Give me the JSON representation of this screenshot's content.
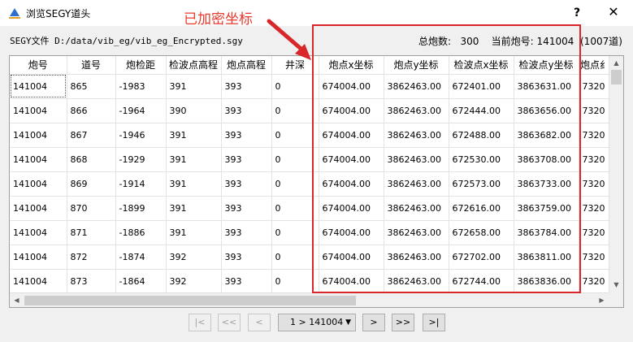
{
  "window": {
    "title": "浏览SEGY道头",
    "help_label": "?",
    "close_label": "✕"
  },
  "annotation": {
    "text": "已加密坐标",
    "color": "#e8392c"
  },
  "info": {
    "file_label": "SEGY文件",
    "file_path": "D:/data/vib_eg/vib_eg_Encrypted.sgy",
    "total_shots_label": "总炮数:",
    "total_shots_value": "300",
    "current_shot_label": "当前炮号:",
    "current_shot_value": "141004",
    "trace_count": "(1007道)"
  },
  "table": {
    "columns": [
      "炮号",
      "道号",
      "炮检距",
      "检波点高程",
      "炮点高程",
      "井深",
      "炮点x坐标",
      "炮点y坐标",
      "检波点x坐标",
      "检波点y坐标",
      "炮点纟"
    ],
    "rows": [
      [
        "141004",
        "865",
        "-1983",
        "391",
        "393",
        "0",
        "674004.00",
        "3862463.00",
        "672401.00",
        "3863631.00",
        "7320"
      ],
      [
        "141004",
        "866",
        "-1964",
        "390",
        "393",
        "0",
        "674004.00",
        "3862463.00",
        "672444.00",
        "3863656.00",
        "7320"
      ],
      [
        "141004",
        "867",
        "-1946",
        "391",
        "393",
        "0",
        "674004.00",
        "3862463.00",
        "672488.00",
        "3863682.00",
        "7320"
      ],
      [
        "141004",
        "868",
        "-1929",
        "391",
        "393",
        "0",
        "674004.00",
        "3862463.00",
        "672530.00",
        "3863708.00",
        "7320"
      ],
      [
        "141004",
        "869",
        "-1914",
        "391",
        "393",
        "0",
        "674004.00",
        "3862463.00",
        "672573.00",
        "3863733.00",
        "7320"
      ],
      [
        "141004",
        "870",
        "-1899",
        "391",
        "393",
        "0",
        "674004.00",
        "3862463.00",
        "672616.00",
        "3863759.00",
        "7320"
      ],
      [
        "141004",
        "871",
        "-1886",
        "391",
        "393",
        "0",
        "674004.00",
        "3862463.00",
        "672658.00",
        "3863784.00",
        "7320"
      ],
      [
        "141004",
        "872",
        "-1874",
        "392",
        "393",
        "0",
        "674004.00",
        "3862463.00",
        "672702.00",
        "3863811.00",
        "7320"
      ],
      [
        "141004",
        "873",
        "-1864",
        "392",
        "393",
        "0",
        "674004.00",
        "3862463.00",
        "672744.00",
        "3863836.00",
        "7320"
      ]
    ]
  },
  "pager": {
    "first_label": "|<",
    "prev_page_label": "<<",
    "prev_label": "<",
    "current_page": "1 > 141004",
    "next_label": ">",
    "next_page_label": ">>",
    "last_label": ">|"
  }
}
